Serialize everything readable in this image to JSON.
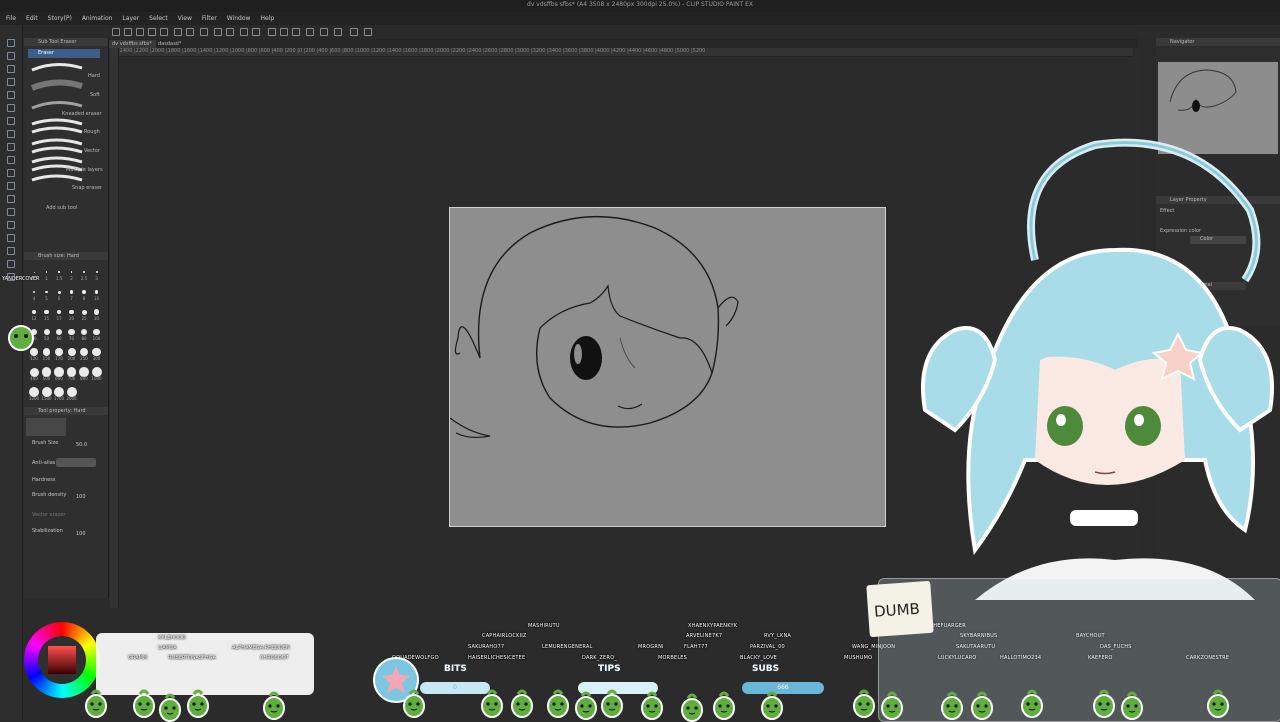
{
  "window": {
    "title": "dv vdsffbs sfbs* (A4 3508 x 2480px 300dpi 25.0%) - CLIP STUDIO PAINT EX"
  },
  "menu": [
    "File",
    "Edit",
    "Story(P)",
    "Animation",
    "Layer",
    "Select",
    "View",
    "Filter",
    "Window",
    "Help"
  ],
  "tabs": [
    "dv vdsffbs sfbs*",
    "dasdasd*"
  ],
  "ruler_ticks": "|2400 |2200 |2000 |1800 |1600 |1400 |1200 |1000 |800 |600 |400 |200 |0 |200 |400 |600 |800 |1000 |1200 |1400 |1600 |1800 |2000 |2200 |2400 |2600 |2800 |3000 |3200 |3400 |3600 |3800 |4000 |4200 |4400 |4600 |4800 |5000 |5200",
  "subtool": {
    "header": "Sub Tool Eraser",
    "group": "Eraser",
    "items": [
      "Hard",
      "Soft",
      "Kneaded eraser",
      "Rough",
      "Vector",
      "Multiple layers",
      "Snap eraser"
    ],
    "add": "Add sub tool"
  },
  "brush_size": {
    "header": "Brush size: Hard",
    "sizes": [
      "0.7",
      "1",
      "1.5",
      "2",
      "2.5",
      "3",
      "4",
      "5",
      "6",
      "7",
      "8",
      "10",
      "12",
      "15",
      "17",
      "20",
      "25",
      "30",
      "40",
      "50",
      "60",
      "70",
      "80",
      "100",
      "120",
      "150",
      "170",
      "200",
      "250",
      "300",
      "400",
      "500",
      "600",
      "700",
      "800",
      "1000",
      "1200",
      "1500",
      "1700",
      "2000"
    ]
  },
  "tool_property": {
    "header": "Tool property: Hard",
    "preset_label": "Hard",
    "brush_size_label": "Brush Size",
    "brush_size_value": "50.0",
    "anti_alias_label": "Anti-alias",
    "hardness_label": "Hardness",
    "brush_density_label": "Brush density",
    "brush_density_value": "100",
    "vector_label": "Vector eraser",
    "stabilization_label": "Stabilization",
    "stabilization_value": "100"
  },
  "navigator": {
    "label": "Navigator"
  },
  "layer_property": {
    "header": "Layer Property",
    "effect": "Effect",
    "expression_color": "Expression color",
    "color_value": "Color",
    "blend": "Normal"
  },
  "overlay": {
    "left_stamp": "YANDERCOVER",
    "credits": [
      "XYLEHOOD",
      "LIAMSA",
      "GRAMM",
      "ROBERTOSASFHGA",
      "ALPHAMEGA.RHEDDEN",
      "CHROSOOT"
    ],
    "bits_label": "BITS",
    "bits_value": "0",
    "tips_label": "TIPS",
    "subs_label": "SUBS",
    "subs_value": "666",
    "sticky_note": "DUMB",
    "names": [
      "MASHIRUTU",
      "XHAENXYPAENKYK",
      "CAPHAIRLOCKIIZ",
      "ARVELINE7K7",
      "RVY_LKNA",
      "LEMURENGENERAL",
      "SAKURAHO77",
      "MROGRNI",
      "FLAH777",
      "PARZIVAL_00",
      "OOUADEWOLFGO",
      "HAISERLICHESICETEE",
      "DARK_ZERO_",
      "MORBELES",
      "BLACKY_LOVE",
      "WANG_MINJOON",
      "MUSHUMO",
      "THEFUARGER",
      "SKYBARNIBUS",
      "SAKUTAARUTU",
      "LUCKYLUCARO",
      "HALLOTIMO234",
      "BAYCHOUT",
      "DAS_FUCHS",
      "KAEFERO",
      "CARKZONESTRE"
    ]
  },
  "colors": {
    "app_bg": "#2b2b2b",
    "canvas": "#8e8e8e",
    "hair": "#a8dce8",
    "eyes": "#4e8a3c",
    "accent_blue": "#6ab6d8",
    "blob_green": "#5fae3e"
  }
}
